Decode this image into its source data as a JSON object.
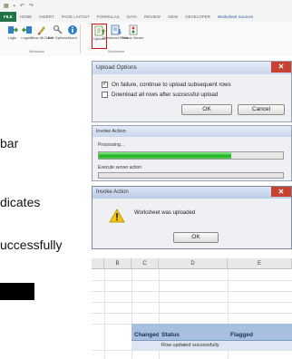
{
  "ribbon": {
    "tabs": [
      "FILE",
      "HOME",
      "INSERT",
      "PAGE LAYOUT",
      "FORMULAS",
      "DATA",
      "REVIEW",
      "VIEW",
      "DEVELOPER",
      "Worksheet Sources"
    ],
    "buttons": [
      {
        "label": "Login",
        "icon": "login-icon",
        "color": "#2f7fd0"
      },
      {
        "label": "Logout",
        "icon": "logout-icon",
        "color": "#2f7fd0"
      },
      {
        "label": "Clear All Data",
        "icon": "clear-icon",
        "color": "#c8a040"
      },
      {
        "label": "Edit Options",
        "icon": "edit-icon",
        "color": "#808080"
      },
      {
        "label": "About",
        "icon": "info-icon",
        "color": "#2f7fd0"
      },
      {
        "label": "Upload",
        "icon": "upload-icon",
        "color": "#2f8f2f"
      },
      {
        "label": "Download Rows",
        "icon": "download-icon",
        "color": "#2f7fd0"
      },
      {
        "label": "Status Viewer",
        "icon": "status-icon",
        "color": "#d04040"
      }
    ],
    "groups": [
      "Workbook",
      "Worksheet"
    ]
  },
  "doc_text": [
    "bar",
    "dicates",
    "uccessfully"
  ],
  "upload_dialog": {
    "title": "Upload Options",
    "option1": "On failure, continue to upload subsequent rows",
    "option2": "Download all rows after successful upload",
    "ok": "OK",
    "cancel": "Cancel"
  },
  "progress_dialog": {
    "title": "Invoke Action",
    "step1": "Processing...",
    "step2": "Execute server action",
    "progress": 0.72
  },
  "message_dialog": {
    "title": "Invoke Action",
    "message": "Worksheet was uploaded",
    "ok": "OK"
  },
  "sheet": {
    "columns": [
      "B",
      "C",
      "D",
      "E"
    ],
    "headers": [
      "Changed",
      "Status",
      "Flagged"
    ],
    "row1_status": "Row updated successfully"
  },
  "colors": {
    "excel_green": "#217346",
    "highlight_red": "#d01010",
    "table_header": "#a9bfdf",
    "progress_green": "#20b020"
  }
}
